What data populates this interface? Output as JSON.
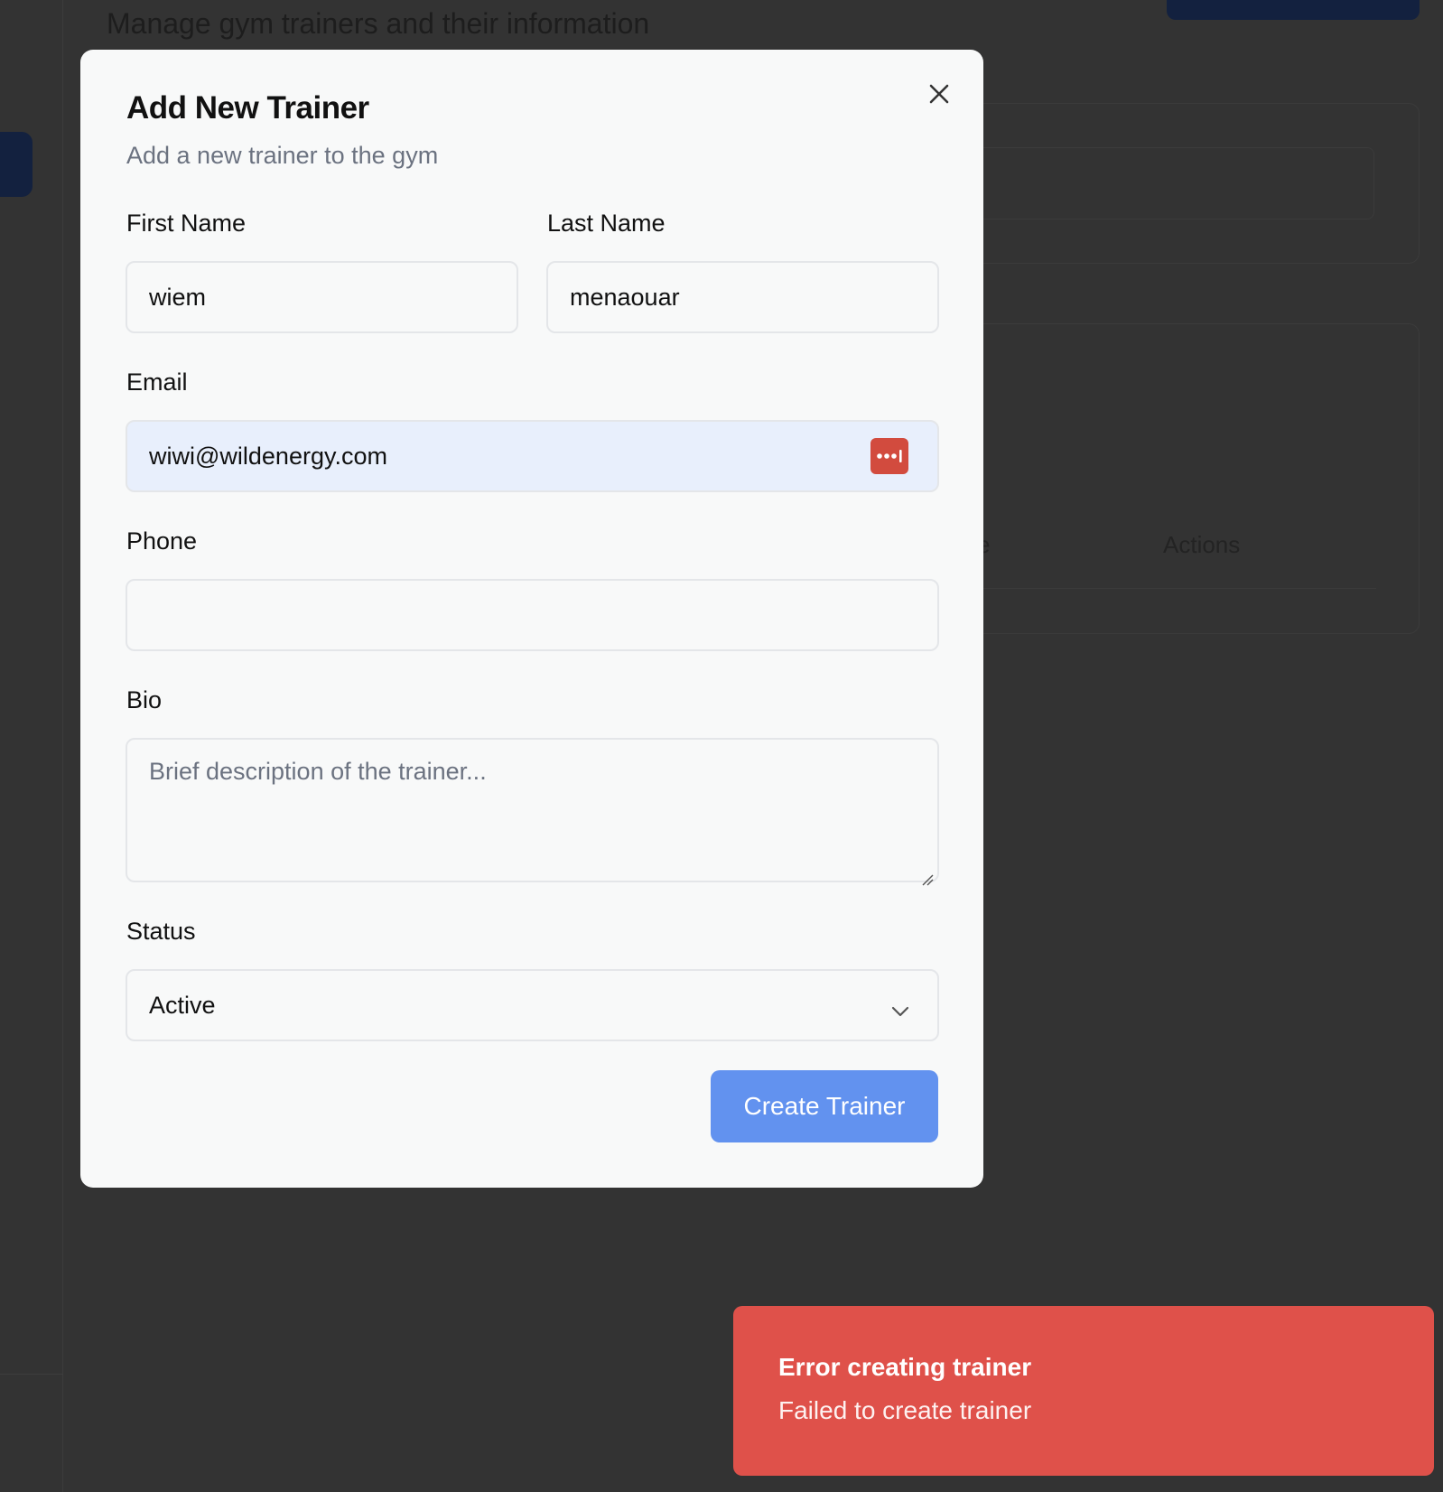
{
  "background": {
    "page_subtitle": "Manage gym trainers and their information",
    "table_header_partial": "e",
    "table_header_actions": "Actions"
  },
  "modal": {
    "title": "Add New Trainer",
    "description": "Add a new trainer to the gym",
    "close_icon": "close-icon",
    "fields": {
      "first_name": {
        "label": "First Name",
        "value": "wiem"
      },
      "last_name": {
        "label": "Last Name",
        "value": "menaouar"
      },
      "email": {
        "label": "Email",
        "value": "wiwi@wildenergy.com",
        "autofill_icon": "password-manager-icon"
      },
      "phone": {
        "label": "Phone",
        "value": ""
      },
      "bio": {
        "label": "Bio",
        "placeholder": "Brief description of the trainer..."
      },
      "status": {
        "label": "Status",
        "value": "Active"
      }
    },
    "submit_label": "Create Trainer"
  },
  "toast": {
    "title": "Error creating trainer",
    "message": "Failed to create trainer"
  },
  "colors": {
    "overlay_background": "#333333",
    "modal_background": "#f8f9f9",
    "primary_button": "#6292ef",
    "autofill_background": "#e8effc",
    "password_manager_icon": "#d24b3e",
    "toast_background": "#df514a",
    "navy_background_element": "#13213f"
  }
}
